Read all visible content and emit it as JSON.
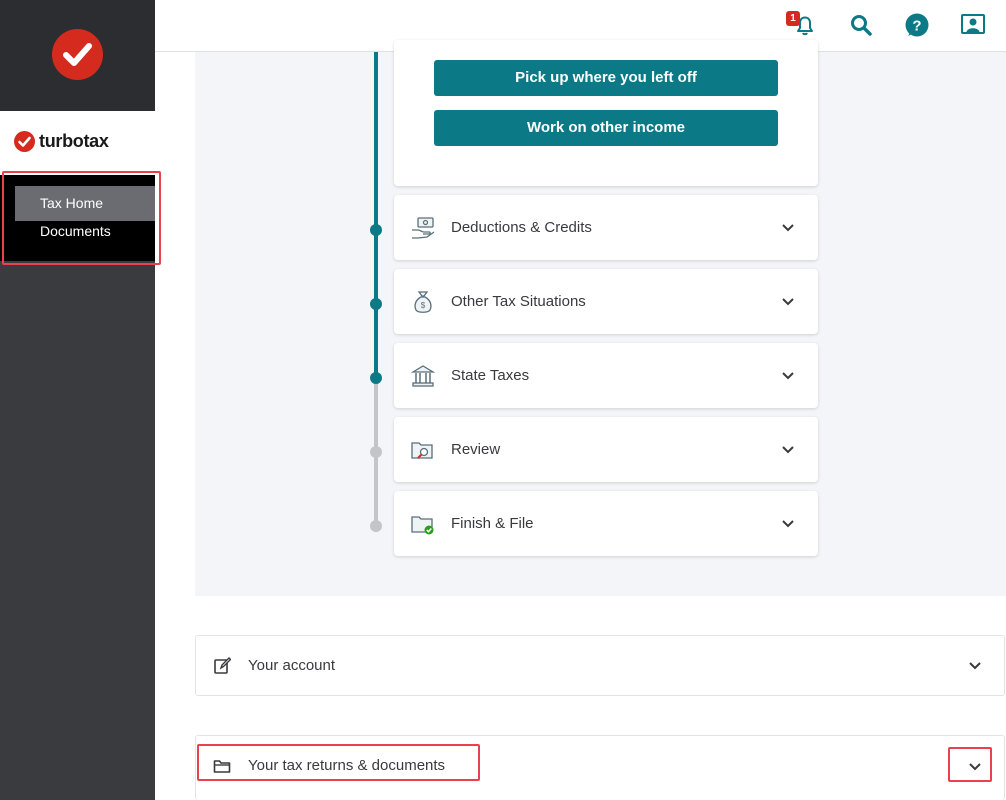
{
  "brand": {
    "name": "turbotax",
    "accent": "#d52b1e"
  },
  "sidebar": {
    "items": [
      {
        "label": "Tax Home",
        "active": true
      },
      {
        "label": "Documents",
        "active": false
      }
    ]
  },
  "header": {
    "notification_count": "1",
    "icons": [
      "bell-icon",
      "search-icon",
      "help-icon",
      "profile-icon"
    ]
  },
  "main": {
    "buttons": [
      {
        "label": "Pick up where you left off"
      },
      {
        "label": "Work on other income"
      }
    ],
    "sections": [
      {
        "label": "Deductions & Credits",
        "icon": "money-hand-icon"
      },
      {
        "label": "Other Tax Situations",
        "icon": "money-bag-icon"
      },
      {
        "label": "State Taxes",
        "icon": "bank-building-icon"
      },
      {
        "label": "Review",
        "icon": "folder-search-icon"
      },
      {
        "label": "Finish & File",
        "icon": "folder-check-icon"
      }
    ]
  },
  "account": {
    "your_account_label": "Your account",
    "tax_returns_label": "Your tax returns & documents"
  },
  "colors": {
    "teal": "#0b7a86",
    "sidebar": "#3a3b3f",
    "highlight": "#e8424f"
  }
}
